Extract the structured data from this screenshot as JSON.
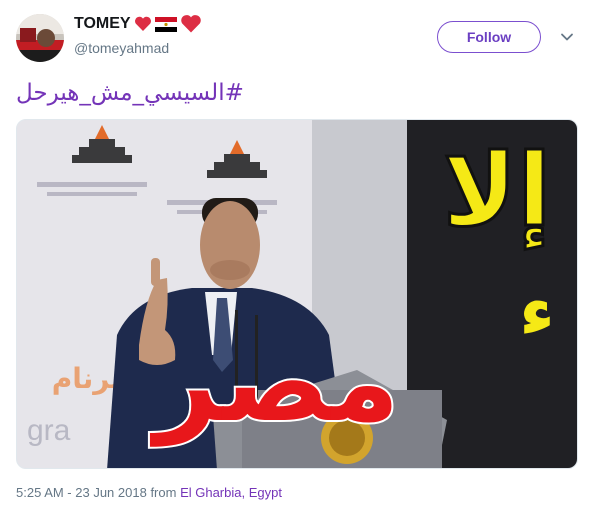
{
  "user": {
    "display_name": "TOMEY",
    "name_emojis": [
      "red-heart",
      "egypt-flag",
      "red-heart"
    ],
    "handle": "@tomeyahmad"
  },
  "follow_label": "Follow",
  "tweet_text": "#السيسي_مش_هيرحل",
  "media": {
    "poster_text_top": "إلا",
    "poster_text_mid": "ء",
    "poster_text_main": "مصر",
    "backdrop_text": "البرنام",
    "backdrop_text2": "gra"
  },
  "meta": {
    "time": "5:25 AM - 23 Jun 2018",
    "from_label": "from",
    "location": "El Gharbia, Egypt"
  },
  "colors": {
    "accent": "#7434b8",
    "poster_yellow": "#f5e916",
    "poster_red": "#e8171b"
  }
}
